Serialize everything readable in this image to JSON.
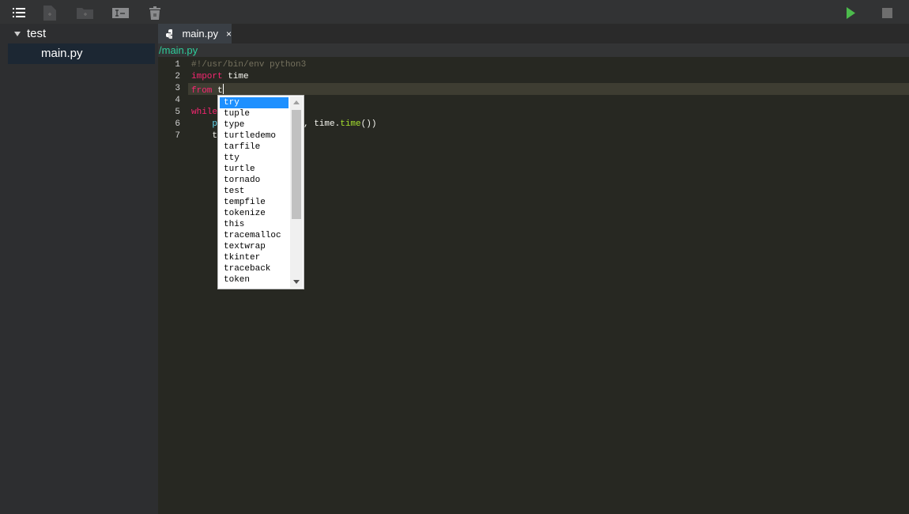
{
  "toolbar": {
    "icons": [
      "list-icon",
      "new-file-icon",
      "new-folder-icon",
      "rename-icon",
      "trash-icon"
    ],
    "run_color": "#4cbb4c",
    "stop_color": "#6e6e6e"
  },
  "sidebar": {
    "root": "test",
    "files": [
      "main.py"
    ]
  },
  "tabs": [
    {
      "label": "main.py",
      "close": "×"
    }
  ],
  "path": "/main.py",
  "editor": {
    "line_numbers": [
      "1",
      "2",
      "3",
      "4",
      "5",
      "6",
      "7"
    ],
    "line1": "#!/usr/bin/env python3",
    "line2_kw": "import",
    "line2_rest": " time",
    "line3_kw": "from",
    "line3_rest": " t",
    "line5_kw": "while",
    "line6_a": "    pr",
    "line6_b": ", time.",
    "line6_fn": "time",
    "line6_c": "())",
    "line7": "    ti"
  },
  "autocomplete": {
    "options": [
      "try",
      "tuple",
      "type",
      "turtledemo",
      "tarfile",
      "tty",
      "turtle",
      "tornado",
      "test",
      "tempfile",
      "tokenize",
      "this",
      "tracemalloc",
      "textwrap",
      "tkinter",
      "traceback",
      "token"
    ],
    "selected": "try"
  }
}
